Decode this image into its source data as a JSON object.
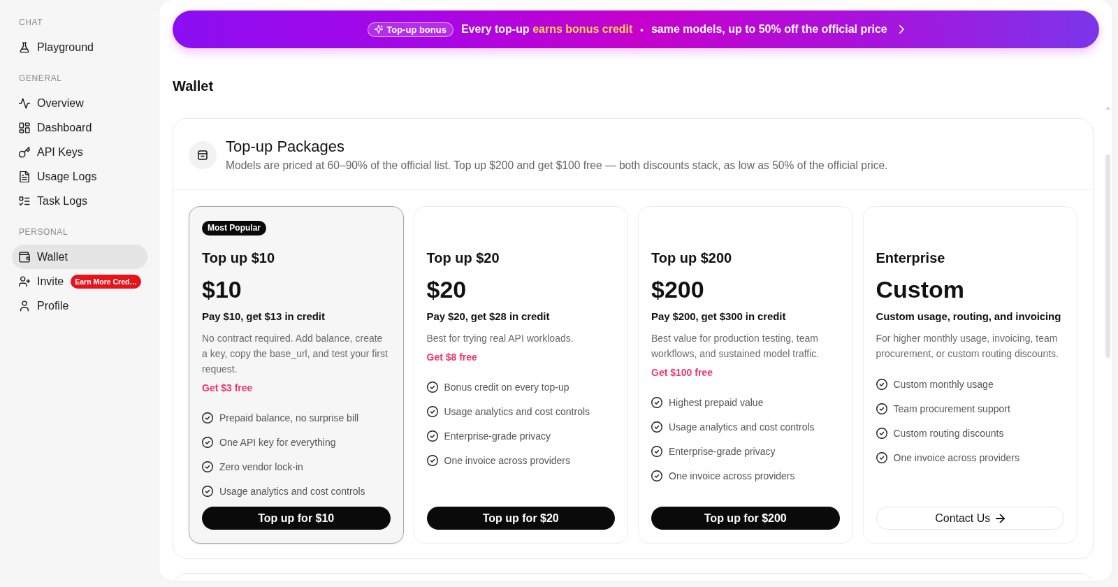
{
  "sidebar": {
    "sections": [
      {
        "heading": "CHAT",
        "items": [
          {
            "label": "Playground",
            "selected": false
          }
        ]
      },
      {
        "heading": "GENERAL",
        "items": [
          {
            "label": "Overview",
            "selected": false
          },
          {
            "label": "Dashboard",
            "selected": false
          },
          {
            "label": "API Keys",
            "selected": false
          },
          {
            "label": "Usage Logs",
            "selected": false
          },
          {
            "label": "Task Logs",
            "selected": false
          }
        ]
      },
      {
        "heading": "PERSONAL",
        "items": [
          {
            "label": "Wallet",
            "selected": true
          },
          {
            "label": "Invite",
            "selected": false,
            "badge": "Earn More Cred…"
          },
          {
            "label": "Profile",
            "selected": false
          }
        ]
      }
    ]
  },
  "banner": {
    "badge": "Top-up bonus",
    "lead": "Every top-up",
    "highlight": "earns bonus credit",
    "separator": "•",
    "detail": "same models, up to 50% off the official price"
  },
  "page_title": "Wallet",
  "packages": {
    "title": "Top-up Packages",
    "subtitle": "Models are priced at 60–90% of the official list. Top up $200 and get $100 free — both discounts stack, as low as 50% of the official price.",
    "cards": [
      {
        "featured": true,
        "badge": "Most Popular",
        "title": "Top up $10",
        "price": "$10",
        "credit": "Pay $10, get $13 in credit",
        "description": "No contract required. Add balance, create a key, copy the base_url, and test your first request.",
        "bonus": "Get $3 free",
        "features": [
          "Prepaid balance, no surprise bill",
          "One API key for everything",
          "Zero vendor lock-in",
          "Usage analytics and cost controls"
        ],
        "button": {
          "label": "Top up for $10",
          "kind": "primary"
        }
      },
      {
        "featured": false,
        "title": "Top up $20",
        "price": "$20",
        "credit": "Pay $20, get $28 in credit",
        "description": "Best for trying real API workloads.",
        "bonus": "Get $8 free",
        "features": [
          "Bonus credit on every top-up",
          "Usage analytics and cost controls",
          "Enterprise-grade privacy",
          "One invoice across providers"
        ],
        "button": {
          "label": "Top up for $20",
          "kind": "primary"
        }
      },
      {
        "featured": false,
        "title": "Top up $200",
        "price": "$200",
        "credit": "Pay $200, get $300 in credit",
        "description": "Best value for production testing, team workflows, and sustained model traffic.",
        "bonus": "Get $100 free",
        "features": [
          "Highest prepaid value",
          "Usage analytics and cost controls",
          "Enterprise-grade privacy",
          "One invoice across providers"
        ],
        "button": {
          "label": "Top up for $200",
          "kind": "primary"
        }
      },
      {
        "featured": false,
        "title": "Enterprise",
        "price": "Custom",
        "credit": "Custom usage, routing, and invoicing",
        "description": "For higher monthly usage, invoicing, team procurement, or custom routing discounts.",
        "features": [
          "Custom monthly usage",
          "Team procurement support",
          "Custom routing discounts",
          "One invoice across providers"
        ],
        "button": {
          "label": "Contact Us",
          "kind": "outline"
        }
      }
    ]
  }
}
